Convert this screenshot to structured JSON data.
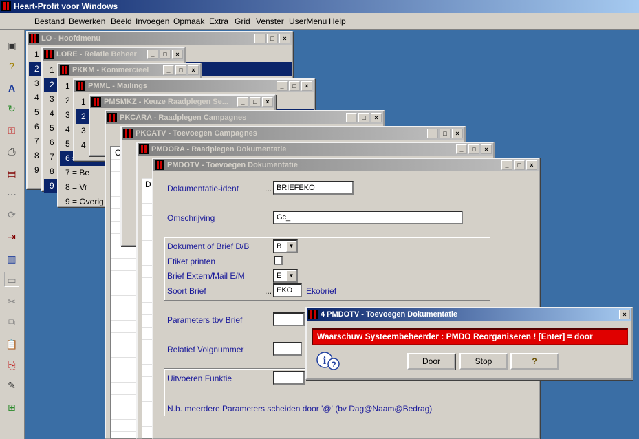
{
  "app": {
    "title": "Heart-Profit voor Windows"
  },
  "menubar": [
    "Bestand",
    "Bewerken",
    "Beeld",
    "Invoegen",
    "Opmaak",
    "Extra",
    "Grid",
    "Venster",
    "UserMenu",
    "Help"
  ],
  "toolbar_icons": [
    "app-window-icon",
    "help-question-icon",
    "font-icon",
    "recycle-icon",
    "key-icon",
    "printer-icon",
    "calculator-icon",
    "dots-icon",
    "refresh-icon",
    "export-icon",
    "chart-icon",
    "window-icon",
    "cut-icon",
    "copy-icon",
    "paste-icon",
    "paste-special-icon",
    "edit-icon",
    "tree-icon"
  ],
  "windows": {
    "lo": {
      "title": "LO - Hoofdmenu",
      "items": [
        "1",
        "2",
        "3",
        "4",
        "5",
        "6",
        "7",
        "8",
        "9"
      ]
    },
    "lore": {
      "title": "LORE - Relatie Beheer",
      "items": [
        "1",
        "2",
        "3",
        "4",
        "5",
        "6",
        "7",
        "8",
        "9"
      ]
    },
    "pkkm": {
      "title": "PKKM - Kommercieel",
      "items": [
        "1",
        "2",
        "3",
        "4",
        "5",
        "6 = Ma",
        "7 = Be",
        "8 = Vr",
        "9 = Overig"
      ]
    },
    "pmml": {
      "title": "PMML - Mailings",
      "items": [
        "1",
        "2",
        "3",
        "4"
      ]
    },
    "pmsmkz": {
      "title": "PMSMKZ - Keuze Raadplegen Se..."
    },
    "pkcara": {
      "title": "PKCARA - Raadplegen Campagnes",
      "grid_col": "C"
    },
    "pkcatv": {
      "title": "PKCATV - Toevoegen Campagnes"
    },
    "pmdora": {
      "title": "PMDORA - Raadplegen Dokumentatie",
      "grid_col": "D"
    },
    "pmdotv": {
      "title": "PMDOTV - Toevoegen Dokumentatie",
      "fields": {
        "dok_ident_label": "Dokumentatie-ident",
        "dok_ident_dots": "...",
        "dok_ident_value": "BRIEFEKO",
        "omschrijving_label": "Omschrijving",
        "omschrijving_value": "Gc_",
        "dok_brief_label": "Dokument of Brief D/B",
        "dok_brief_value": "B",
        "etiket_label": "Etiket printen",
        "brief_extern_label": "Brief Extern/Mail E/M",
        "brief_extern_value": "E",
        "soort_label": "Soort Brief",
        "soort_dots": "...",
        "soort_value": "EKO",
        "soort_desc": "Ekobrief",
        "params_label": "Parameters tbv Brief",
        "relatief_label": "Relatief Volgnummer",
        "uitvoeren_label": "Uitvoeren Funktie",
        "note": "N.b. meerdere Parameters scheiden door '@' (bv Dag@Naam@Bedrag)"
      }
    }
  },
  "dialog": {
    "title": "4 PMDOTV - Toevoegen Dokumentatie",
    "message": "Waarschuw Systeembeheerder : PMDO Reorganiseren !  [Enter] = door",
    "buttons": {
      "door": "Door",
      "stop": "Stop",
      "help": "?"
    }
  },
  "colors": {
    "alert_bg": "#e00000",
    "title_active": "#0a246a",
    "label": "#1a1a9a"
  }
}
